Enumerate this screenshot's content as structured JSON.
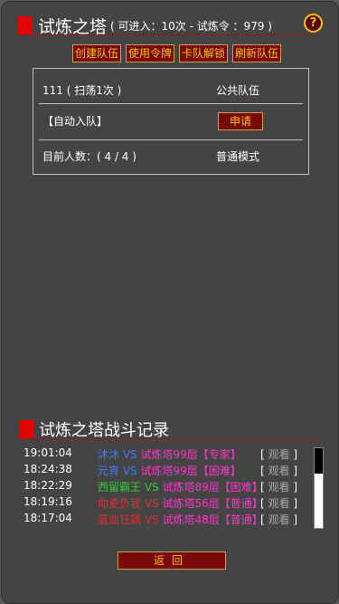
{
  "header": {
    "title": "试炼之塔",
    "subtitle": "( 可进入：10次 - 试炼令 ：979 )",
    "help": "?"
  },
  "top_buttons": [
    "创建队伍",
    "使用令牌",
    "卡队解锁",
    "刷新队伍"
  ],
  "team": {
    "name": "111 ( 扫荡1次 )",
    "type": "公共队伍",
    "auto_join": "【自动入队】",
    "apply_label": "申请",
    "member_count": "目前人数：( 4 / 4 )",
    "mode": "普通模式"
  },
  "log": {
    "title": "试炼之塔战斗记录",
    "entries": [
      {
        "time": "19:01:04",
        "player": "沐沐",
        "player_color": "#4477ff",
        "vs": " VS ",
        "level": "试炼塔99层【专家】",
        "watch_open": "[",
        "watch": " 观看 ",
        "watch_close": "]"
      },
      {
        "time": "18:24:38",
        "player": "元宵",
        "player_color": "#4477ff",
        "vs": " VS ",
        "level": "试炼塔99层【困难】",
        "watch_open": "[",
        "watch": " 观看 ",
        "watch_close": "]"
      },
      {
        "time": "18:22:29",
        "player": "西留霸王",
        "player_color": "#33cc33",
        "vs": " VS ",
        "level": "试炼塔89层【困难】",
        "watch_open": "[",
        "watch": " 观看 ",
        "watch_close": "]"
      },
      {
        "time": "18:19:16",
        "player": "你麦负我",
        "player_color": "#e03030",
        "vs": " VS ",
        "level": "试炼塔56层【普通】",
        "watch_open": "[",
        "watch": " 观看 ",
        "watch_close": "]"
      },
      {
        "time": "18:17:04",
        "player": "蓝血狂飙",
        "player_color": "#e03030",
        "vs": " VS ",
        "level": "试炼塔48层【普通】",
        "watch_open": "[",
        "watch": " 观看 ",
        "watch_close": "]"
      }
    ]
  },
  "back_label": "返回",
  "colors": {
    "accent_red": "#e80000",
    "button_bg": "#7a0a0a",
    "button_text": "#f0c020"
  }
}
